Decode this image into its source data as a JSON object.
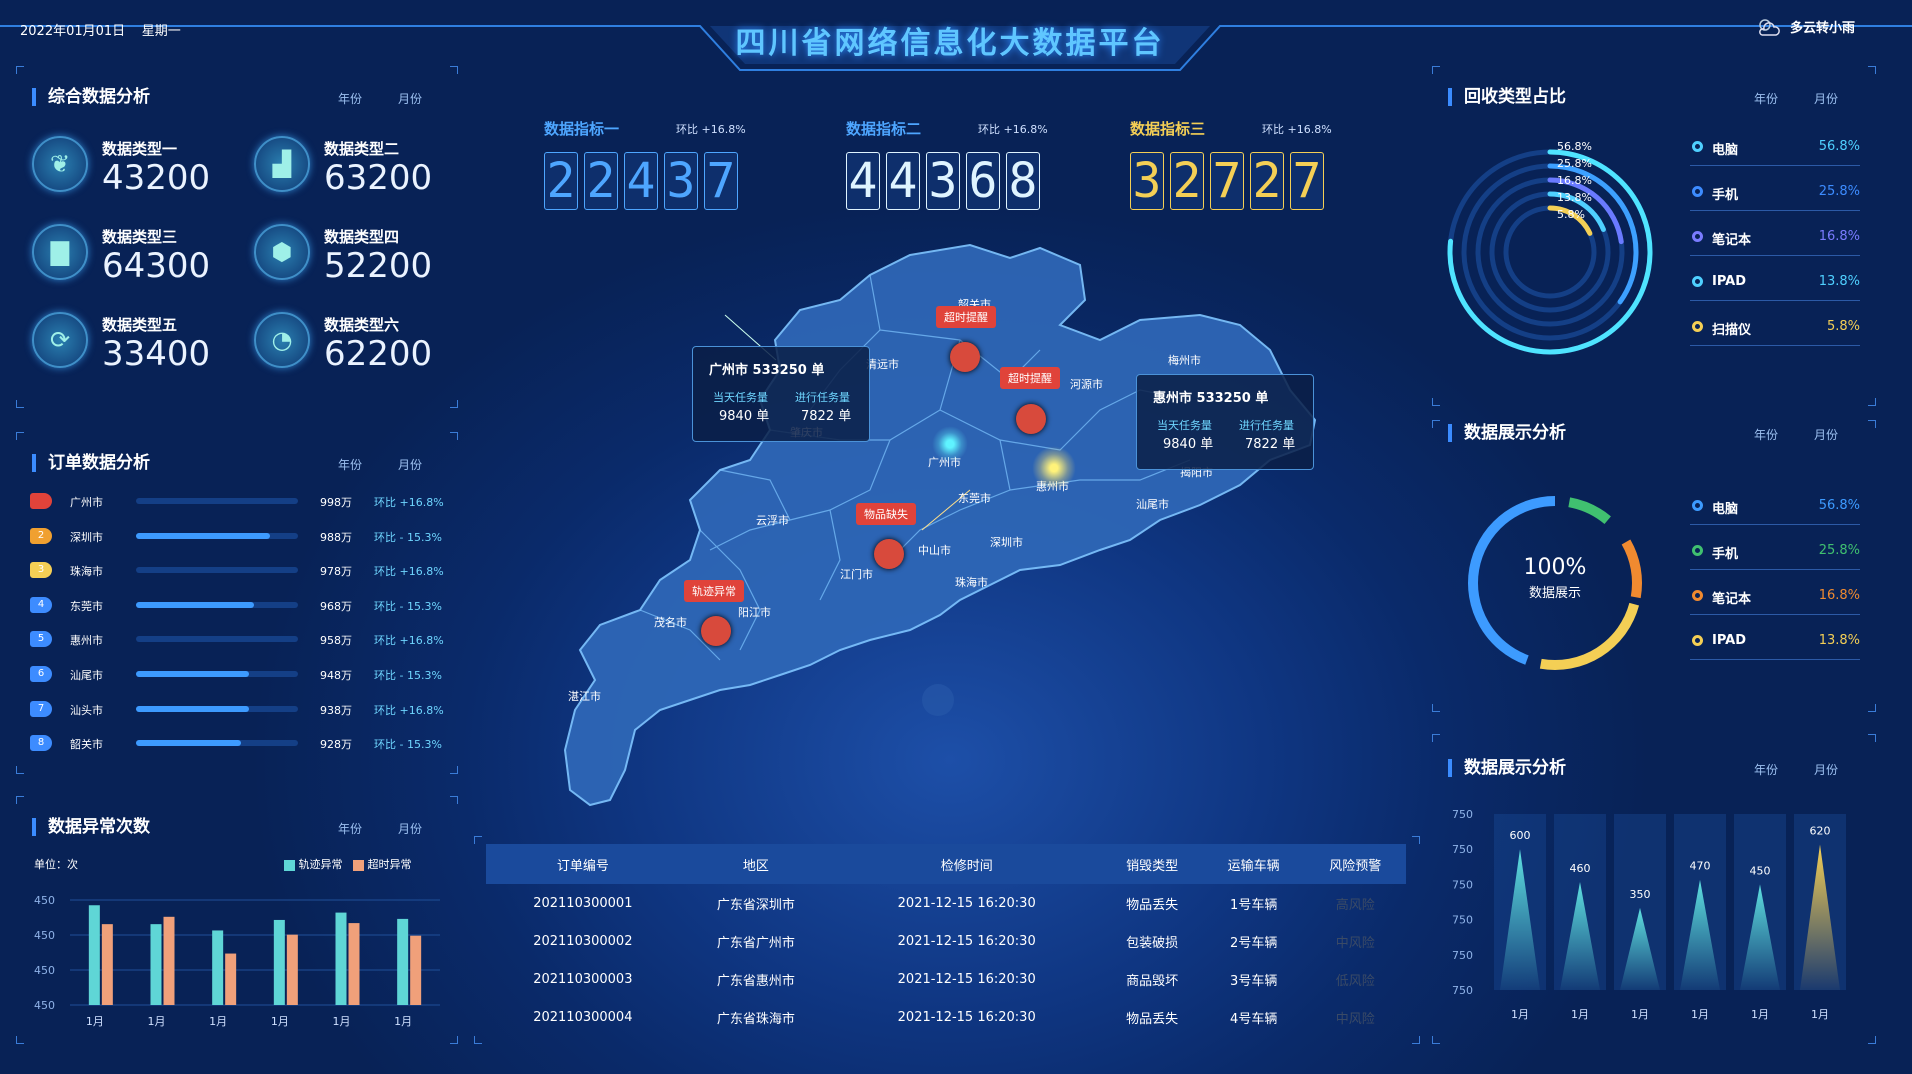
{
  "header": {
    "date": "2022年01月01日",
    "weekday": "星期一",
    "title": "四川省网络信息化大数据平台",
    "weather": "多云转小雨"
  },
  "tabs": {
    "year": "年份",
    "month": "月份"
  },
  "comprehensive": {
    "title": "综合数据分析",
    "items": [
      {
        "label": "数据类型一",
        "value": "43200",
        "icon": "sprout-icon"
      },
      {
        "label": "数据类型二",
        "value": "63200",
        "icon": "area-chart-icon"
      },
      {
        "label": "数据类型三",
        "value": "64300",
        "icon": "bar-chart-icon"
      },
      {
        "label": "数据类型四",
        "value": "52200",
        "icon": "cube-icon"
      },
      {
        "label": "数据类型五",
        "value": "33400",
        "icon": "refresh-icon"
      },
      {
        "label": "数据类型六",
        "value": "62200",
        "icon": "pie-chart-icon"
      }
    ]
  },
  "indicators": [
    {
      "label": "数据指标一",
      "change": "环比 +16.8%",
      "digits": [
        "2",
        "2",
        "4",
        "3",
        "7"
      ],
      "color": "#4ea6ff"
    },
    {
      "label": "数据指标二",
      "change": "环比 +16.8%",
      "digits": [
        "4",
        "4",
        "3",
        "6",
        "8"
      ],
      "color": "#dff4ff"
    },
    {
      "label": "数据指标三",
      "change": "环比 +16.8%",
      "digits": [
        "3",
        "2",
        "7",
        "2",
        "7"
      ],
      "color": "#f4cf55"
    }
  ],
  "orders": {
    "title": "订单数据分析",
    "rows": [
      {
        "rank": "1",
        "city": "广州市",
        "value": "998万",
        "change": "环比 +16.8%",
        "fill": 0,
        "color": "#e0433a"
      },
      {
        "rank": "2",
        "city": "深圳市",
        "value": "988万",
        "change": "环比 - 15.3%",
        "fill": 0.83,
        "color": "#f0a030"
      },
      {
        "rank": "3",
        "city": "珠海市",
        "value": "978万",
        "change": "环比 +16.8%",
        "fill": 0,
        "color": "#f4cf55"
      },
      {
        "rank": "4",
        "city": "东莞市",
        "value": "968万",
        "change": "环比 - 15.3%",
        "fill": 0.73,
        "color": "#3d8cff"
      },
      {
        "rank": "5",
        "city": "惠州市",
        "value": "958万",
        "change": "环比 +16.8%",
        "fill": 0,
        "color": "#3d8cff"
      },
      {
        "rank": "6",
        "city": "汕尾市",
        "value": "948万",
        "change": "环比 - 15.3%",
        "fill": 0.7,
        "color": "#3d8cff"
      },
      {
        "rank": "7",
        "city": "汕头市",
        "value": "938万",
        "change": "环比 +16.8%",
        "fill": 0.7,
        "color": "#3d8cff"
      },
      {
        "rank": "8",
        "city": "韶关市",
        "value": "928万",
        "change": "环比 - 15.3%",
        "fill": 0.65,
        "color": "#3d8cff"
      }
    ]
  },
  "anomaly": {
    "title": "数据异常次数",
    "unit": "单位：次",
    "legend": [
      "轨迹异常",
      "超时异常"
    ],
    "chart_data": {
      "type": "bar",
      "categories": [
        "1月",
        "1月",
        "1月",
        "1月",
        "1月",
        "1月"
      ],
      "y_tick_labels": [
        "450",
        "450",
        "450",
        "450"
      ],
      "series": [
        {
          "name": "轨迹异常",
          "values": [
            0.95,
            0.77,
            0.71,
            0.81,
            0.88,
            0.82
          ],
          "color": "#5fd6d6"
        },
        {
          "name": "超时异常",
          "values": [
            0.77,
            0.84,
            0.49,
            0.67,
            0.78,
            0.66
          ],
          "color": "#f0a07a"
        }
      ]
    }
  },
  "map": {
    "cities": [
      {
        "name": "韶关市"
      },
      {
        "name": "清远市"
      },
      {
        "name": "河源市"
      },
      {
        "name": "梅州市"
      },
      {
        "name": "广州市"
      },
      {
        "name": "东莞市"
      },
      {
        "name": "惠州市"
      },
      {
        "name": "汕尾市"
      },
      {
        "name": "揭阳市"
      },
      {
        "name": "云浮市"
      },
      {
        "name": "中山市"
      },
      {
        "name": "深圳市"
      },
      {
        "name": "江门市"
      },
      {
        "name": "珠海市"
      },
      {
        "name": "阳江市"
      },
      {
        "name": "茂名市"
      },
      {
        "name": "湛江市"
      },
      {
        "name": "肇庆市"
      }
    ],
    "alerts": [
      "超时提醒",
      "超时提醒",
      "物品缺失",
      "轨迹异常"
    ],
    "popups": [
      {
        "title": "广州市  533250 单",
        "l1": "当天任务量",
        "v1": "9840 单",
        "l2": "进行任务量",
        "v2": "7822 单"
      },
      {
        "title": "惠州市  533250 单",
        "l1": "当天任务量",
        "v1": "9840 单",
        "l2": "进行任务量",
        "v2": "7822 单"
      }
    ]
  },
  "table": {
    "headers": [
      "订单编号",
      "地区",
      "检修时间",
      "销毁类型",
      "运输车辆",
      "风险预警"
    ],
    "rows": [
      [
        "202110300001",
        "广东省深圳市",
        "2021-12-15 16:20:30",
        "物品丢失",
        "1号车辆",
        "高风险"
      ],
      [
        "202110300002",
        "广东省广州市",
        "2021-12-15 16:20:30",
        "包装破损",
        "2号车辆",
        "中风险"
      ],
      [
        "202110300003",
        "广东省惠州市",
        "2021-12-15 16:20:30",
        "商品毁坏",
        "3号车辆",
        "低风险"
      ],
      [
        "202110300004",
        "广东省珠海市",
        "2021-12-15 16:20:30",
        "物品丢失",
        "4号车辆",
        "中风险"
      ]
    ]
  },
  "recycle": {
    "title": "回收类型占比",
    "ring_labels": [
      "56.8%",
      "25.8%",
      "16.8%",
      "13.8%",
      "5.8%"
    ],
    "items": [
      {
        "name": "电脑",
        "pct": "56.8%",
        "color": "#4fd0ff",
        "value": 0.568
      },
      {
        "name": "手机",
        "pct": "25.8%",
        "color": "#3d8cff",
        "value": 0.258
      },
      {
        "name": "笔记本",
        "pct": "16.8%",
        "color": "#7a7cff",
        "value": 0.168
      },
      {
        "name": "IPAD",
        "pct": "13.8%",
        "color": "#4fd0ff",
        "value": 0.138
      },
      {
        "name": "扫描仪",
        "pct": "5.8%",
        "color": "#f4cf55",
        "value": 0.058
      }
    ]
  },
  "display1": {
    "title": "数据展示分析",
    "center_pct": "100%",
    "center_label": "数据展示",
    "items": [
      {
        "name": "电脑",
        "pct": "56.8%",
        "color": "#3d9bff"
      },
      {
        "name": "手机",
        "pct": "25.8%",
        "color": "#40c070"
      },
      {
        "name": "笔记本",
        "pct": "16.8%",
        "color": "#f08a30"
      },
      {
        "name": "IPAD",
        "pct": "13.8%",
        "color": "#f4cf55"
      }
    ]
  },
  "display2": {
    "title": "数据展示分析",
    "chart_data": {
      "type": "area",
      "categories": [
        "1月",
        "1月",
        "1月",
        "1月",
        "1月",
        "1月"
      ],
      "values": [
        600,
        460,
        350,
        470,
        450,
        620
      ],
      "y_tick_labels": [
        "750",
        "750",
        "750",
        "750",
        "750",
        "750"
      ],
      "ylim": [
        0,
        750
      ]
    }
  }
}
